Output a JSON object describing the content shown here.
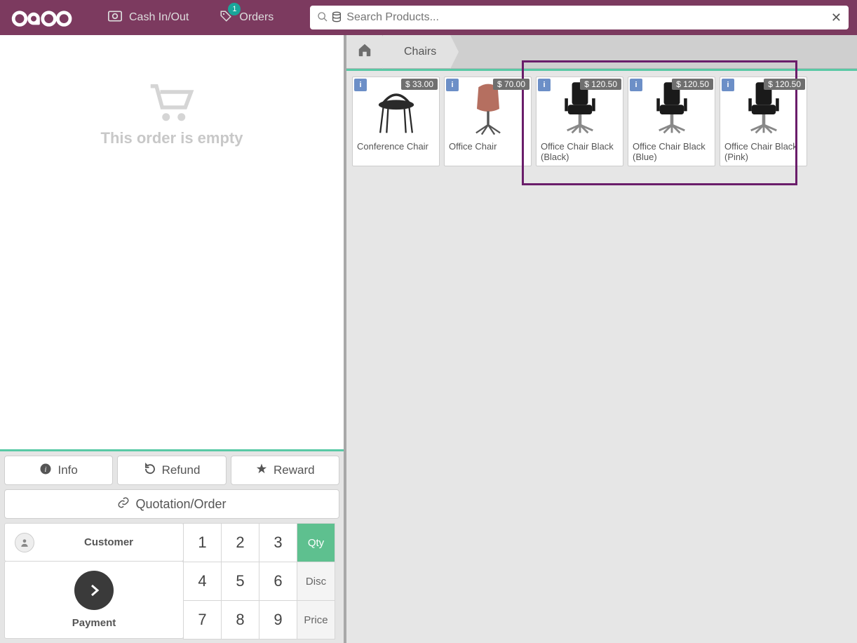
{
  "header": {
    "cash_label": "Cash In/Out",
    "orders_label": "Orders",
    "orders_badge": "1",
    "search_placeholder": "Search Products..."
  },
  "breadcrumb": {
    "category": "Chairs"
  },
  "order": {
    "empty_text": "This order is empty"
  },
  "actions": {
    "info": "Info",
    "refund": "Refund",
    "reward": "Reward",
    "quotation": "Quotation/Order"
  },
  "pad": {
    "customer": "Customer",
    "payment": "Payment",
    "qty": "Qty",
    "disc": "Disc",
    "price": "Price",
    "k1": "1",
    "k2": "2",
    "k3": "3",
    "k4": "4",
    "k5": "5",
    "k6": "6",
    "k7": "7",
    "k8": "8",
    "k9": "9"
  },
  "products": [
    {
      "name": "Conference Chair",
      "price": "$ 33.00",
      "type": "conf"
    },
    {
      "name": "Office Chair",
      "price": "$ 70.00",
      "type": "stool"
    },
    {
      "name": "Office Chair Black (Black)",
      "price": "$ 120.50",
      "type": "exec"
    },
    {
      "name": "Office Chair Black (Blue)",
      "price": "$ 120.50",
      "type": "exec"
    },
    {
      "name": "Office Chair Black (Pink)",
      "price": "$ 120.50",
      "type": "exec"
    }
  ]
}
